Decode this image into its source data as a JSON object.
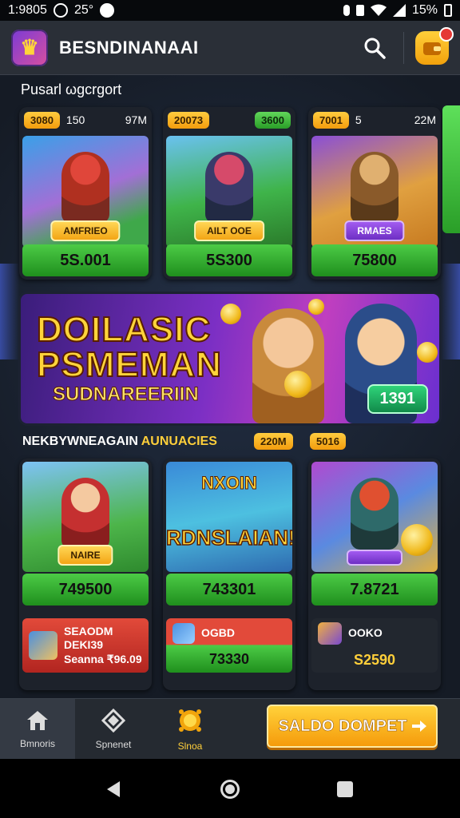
{
  "status_bar": {
    "time": "1:9805",
    "notif_text": "25°",
    "battery": "15%"
  },
  "header": {
    "app_title": "BESNDINANAAI"
  },
  "section1": {
    "title": "Pusarl ωgcrgort"
  },
  "top_cards": [
    {
      "pill": "3080",
      "meta1": "150",
      "meta2": "97M",
      "tag": "AMFRIEO",
      "price": "5S.001"
    },
    {
      "pill": "20073",
      "pill2": "3600",
      "meta1": "",
      "meta2": "",
      "tag": "AILT OOE",
      "price": "5S300"
    },
    {
      "pill": "7001",
      "meta1": "5",
      "meta2": "22M",
      "tag": "RMAES",
      "price": "75800"
    }
  ],
  "banner": {
    "title_line1": "DOILASIC",
    "title_line2": "PSMEMAN",
    "subtitle": "SUDNAREERIIN",
    "price": "1391"
  },
  "section2": {
    "title_main": "NEKBYWNEAGAIN",
    "title_accent": "AUNUACIES",
    "pill_mid": "220M",
    "pill_right": "5016"
  },
  "bottom_cards": [
    {
      "tag": "NAIRE",
      "price": "749500"
    },
    {
      "art_top": "NXOIN",
      "art_main": "RDNSLAIAN!",
      "price": "743301"
    },
    {
      "tag": "",
      "price": "7.8721"
    }
  ],
  "mini_cards": [
    {
      "line1": "SEAODM",
      "line2": "DEKI39",
      "line3": "Seanna ₹96.09"
    },
    {
      "label": "OGBD",
      "price": "73330"
    },
    {
      "label": "OOKO",
      "price": "S2590"
    }
  ],
  "bottom_nav": {
    "home_label": "Bmnoris",
    "nav2_label": "Spnenet",
    "nav3_label": "Slnoa",
    "saldo_label": "SALDO DOMPET"
  },
  "colors": {
    "accent_gold": "#ffcf3a",
    "accent_green": "#2a9e28",
    "header_bg": "#2a2f37",
    "banner_purple": "#7b2fc4"
  },
  "icons": [
    "wifi-icon",
    "signal-icon",
    "battery-icon",
    "search-icon",
    "wallet-icon",
    "home-icon",
    "box-icon",
    "coin-icon",
    "arrow-right-icon",
    "back-icon",
    "home-circle-icon",
    "recent-apps-icon"
  ]
}
